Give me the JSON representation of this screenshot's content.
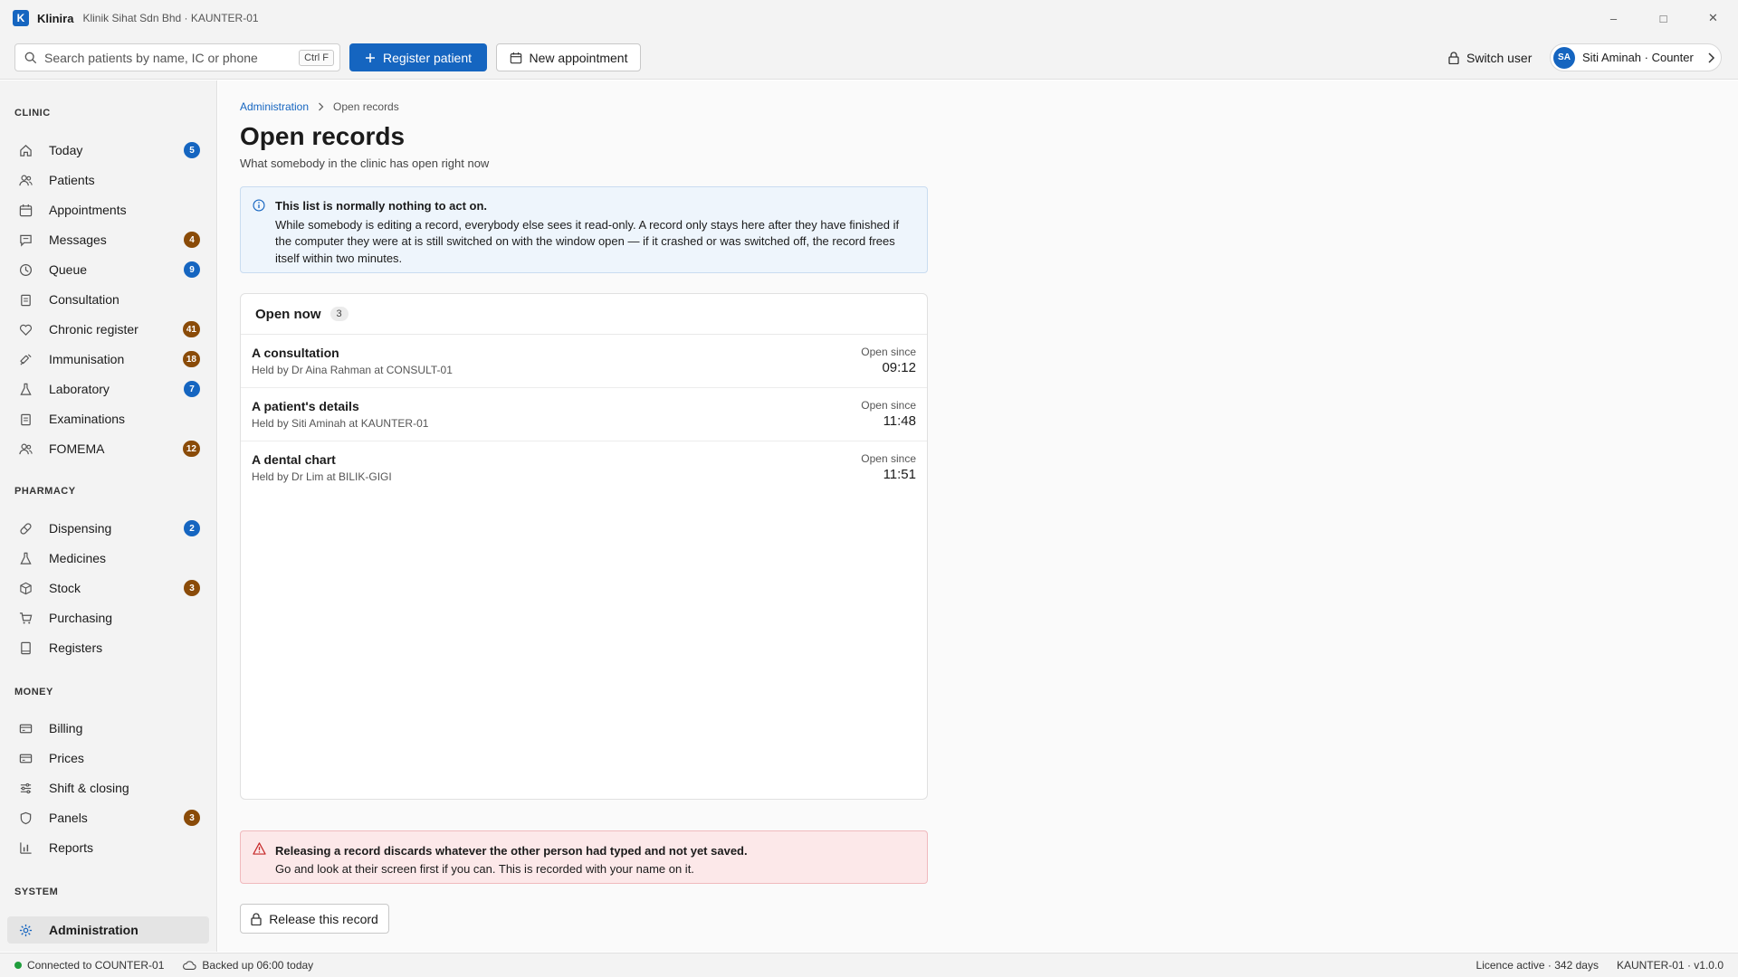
{
  "window": {
    "logo_letter": "K",
    "app_name": "Klinira",
    "context": "Klinik Sihat Sdn Bhd · KAUNTER-01",
    "minimize": "–",
    "maximize": "□",
    "close": "✕"
  },
  "toolbar": {
    "search_placeholder": "Search patients by name, IC or phone",
    "search_shortcut": "Ctrl F",
    "register_label": "Register patient",
    "appointment_label": "New appointment",
    "switch_user_label": "Switch user",
    "user_initials": "SA",
    "user_label": "Siti Aminah · Counter"
  },
  "sidebar": {
    "sections": {
      "clinic": "CLINIC",
      "pharmacy": "PHARMACY",
      "money": "MONEY",
      "system": "SYSTEM"
    },
    "items": {
      "today": {
        "label": "Today",
        "badge": "5",
        "icon": "home-icon"
      },
      "patients": {
        "label": "Patients",
        "icon": "people-icon"
      },
      "appointments": {
        "label": "Appointments",
        "icon": "calendar-icon"
      },
      "messages": {
        "label": "Messages",
        "badge": "4",
        "icon": "message-icon"
      },
      "queue": {
        "label": "Queue",
        "badge": "9",
        "icon": "clock-icon"
      },
      "consultation": {
        "label": "Consultation",
        "icon": "clipboard-icon"
      },
      "chronic": {
        "label": "Chronic register",
        "badge": "41",
        "icon": "heart-icon"
      },
      "immunisation": {
        "label": "Immunisation",
        "badge": "18",
        "icon": "syringe-icon"
      },
      "laboratory": {
        "label": "Laboratory",
        "badge": "7",
        "icon": "flask-icon"
      },
      "examinations": {
        "label": "Examinations",
        "icon": "clipboard-icon"
      },
      "fomema": {
        "label": "FOMEMA",
        "badge": "12",
        "icon": "people-icon"
      },
      "dispensing": {
        "label": "Dispensing",
        "badge": "2",
        "icon": "pill-icon"
      },
      "medicines": {
        "label": "Medicines",
        "icon": "flask-icon"
      },
      "stock": {
        "label": "Stock",
        "badge": "3",
        "icon": "box-icon"
      },
      "purchasing": {
        "label": "Purchasing",
        "icon": "cart-icon"
      },
      "registers": {
        "label": "Registers",
        "icon": "book-icon"
      },
      "billing": {
        "label": "Billing",
        "icon": "card-icon"
      },
      "prices": {
        "label": "Prices",
        "icon": "card-icon"
      },
      "shift": {
        "label": "Shift & closing",
        "icon": "sliders-icon"
      },
      "panels": {
        "label": "Panels",
        "badge": "3",
        "icon": "shield-icon"
      },
      "reports": {
        "label": "Reports",
        "icon": "bar-chart-icon"
      },
      "administration": {
        "label": "Administration",
        "icon": "gear-icon"
      }
    }
  },
  "colors": {
    "accent": "#1565c0",
    "badge_blue": "#1565c0",
    "badge_brown": "#8a4b08",
    "info_bg": "#eef5fc",
    "warn_bg": "#fce8e9",
    "online": "#1f9d3c"
  },
  "main": {
    "breadcrumb_parent": "Administration",
    "breadcrumb_current": "Open records",
    "title": "Open records",
    "subtitle": "What somebody in the clinic has open right now",
    "info_title": "This list is normally nothing to act on.",
    "info_body": "While somebody is editing a record, everybody else sees it read-only. A record only stays here after they have finished if the computer they were at is still switched on with the window open — if it crashed or was switched off, the record frees itself within two minutes.",
    "card_title": "Open now",
    "card_count": "3",
    "records": [
      {
        "title": "A consultation",
        "held_by": "Held by Dr Aina Rahman at CONSULT-01",
        "since_label": "Open since",
        "time": "09:12"
      },
      {
        "title": "A patient's details",
        "held_by": "Held by Siti Aminah at KAUNTER-01",
        "since_label": "Open since",
        "time": "11:48"
      },
      {
        "title": "A dental chart",
        "held_by": "Held by Dr Lim at BILIK-GIGI",
        "since_label": "Open since",
        "time": "11:51"
      }
    ],
    "warn_title": "Releasing a record discards whatever the other person had typed and not yet saved.",
    "warn_body": "Go and look at their screen first if you can. This is recorded with your name on it.",
    "release_label": "Release this record"
  },
  "status": {
    "connection": "Connected to COUNTER-01",
    "backup": "Backed up 06:00 today",
    "licence": "Licence active · 342 days",
    "version": "KAUNTER-01 · v1.0.0"
  }
}
